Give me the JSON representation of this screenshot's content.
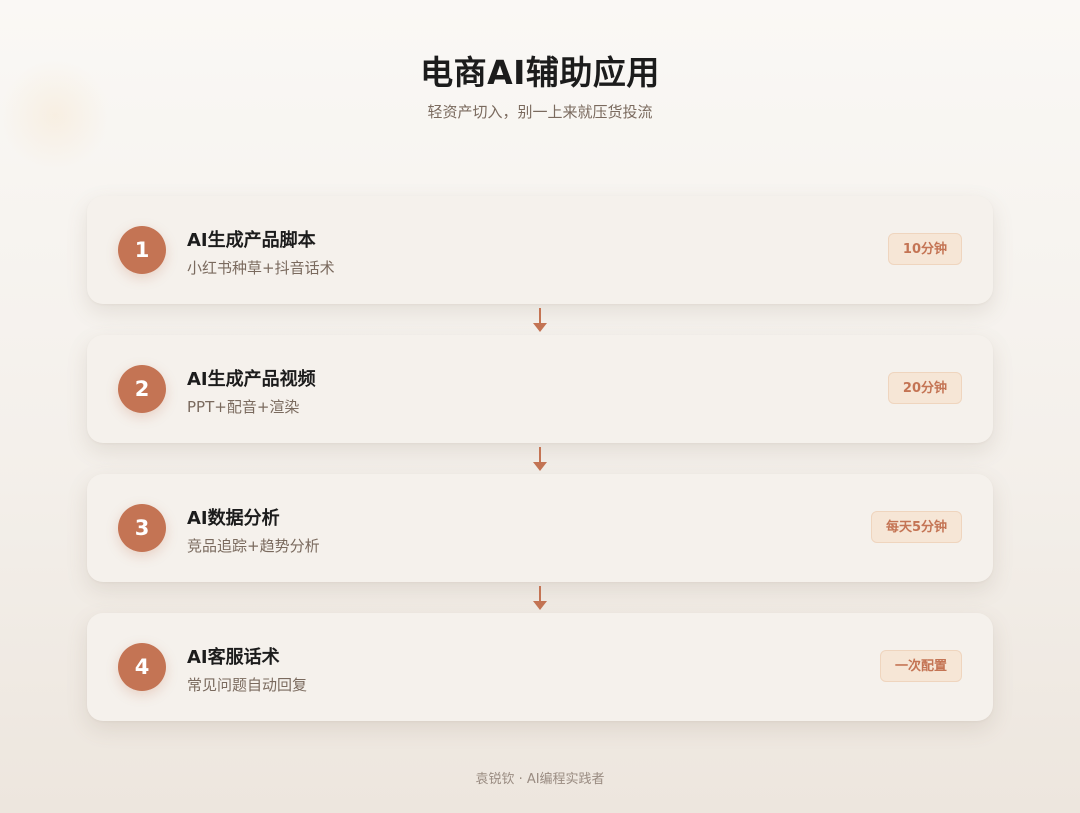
{
  "header": {
    "title": "电商AI辅助应用",
    "subtitle": "轻资产切入，别一上来就压货投流"
  },
  "steps": [
    {
      "number": "1",
      "title": "AI生成产品脚本",
      "description": "小红书种草+抖音话术",
      "badge": "10分钟"
    },
    {
      "number": "2",
      "title": "AI生成产品视频",
      "description": "PPT+配音+渲染",
      "badge": "20分钟"
    },
    {
      "number": "3",
      "title": "AI数据分析",
      "description": "竞品追踪+趋势分析",
      "badge": "每天5分钟"
    },
    {
      "number": "4",
      "title": "AI客服话术",
      "description": "常见问题自动回复",
      "badge": "一次配置"
    }
  ],
  "footer": {
    "text": "袁锐钦 · AI编程实践者"
  },
  "colors": {
    "accent": "#c47454",
    "badge_background": "#f6e6d6",
    "card_background": "#f5f1ec",
    "title_text": "#1c1c1c",
    "secondary_text": "#7a6a5e"
  },
  "icons": {
    "step_connector": "down-arrow-icon"
  }
}
